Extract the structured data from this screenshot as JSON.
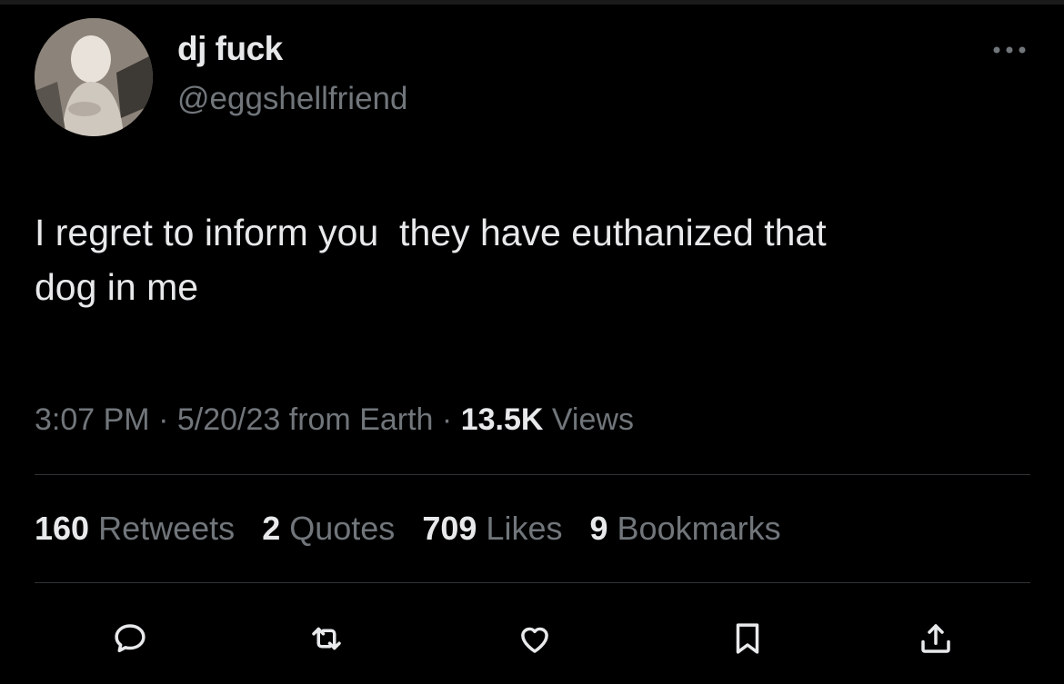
{
  "tweet": {
    "display_name": "dj fuck",
    "handle": "@eggshellfriend",
    "more_icon": "more-dots-icon",
    "text": "I regret to inform you  they have euthanized that\ndog in me",
    "meta": {
      "time": "3:07 PM",
      "separator": " · ",
      "date": "5/20/23",
      "source": " from Earth",
      "views_count": "13.5K",
      "views_label": " Views"
    },
    "stats": [
      {
        "count": "160",
        "label": "Retweets"
      },
      {
        "count": "2",
        "label": "Quotes"
      },
      {
        "count": "709",
        "label": "Likes"
      },
      {
        "count": "9",
        "label": "Bookmarks"
      }
    ],
    "actions": [
      "reply-icon",
      "retweet-icon",
      "like-icon",
      "bookmark-icon",
      "share-icon"
    ]
  },
  "colors": {
    "background": "#000000",
    "primary_text": "#e7e9ea",
    "secondary_text": "#71767b",
    "divider": "#2f3336"
  }
}
